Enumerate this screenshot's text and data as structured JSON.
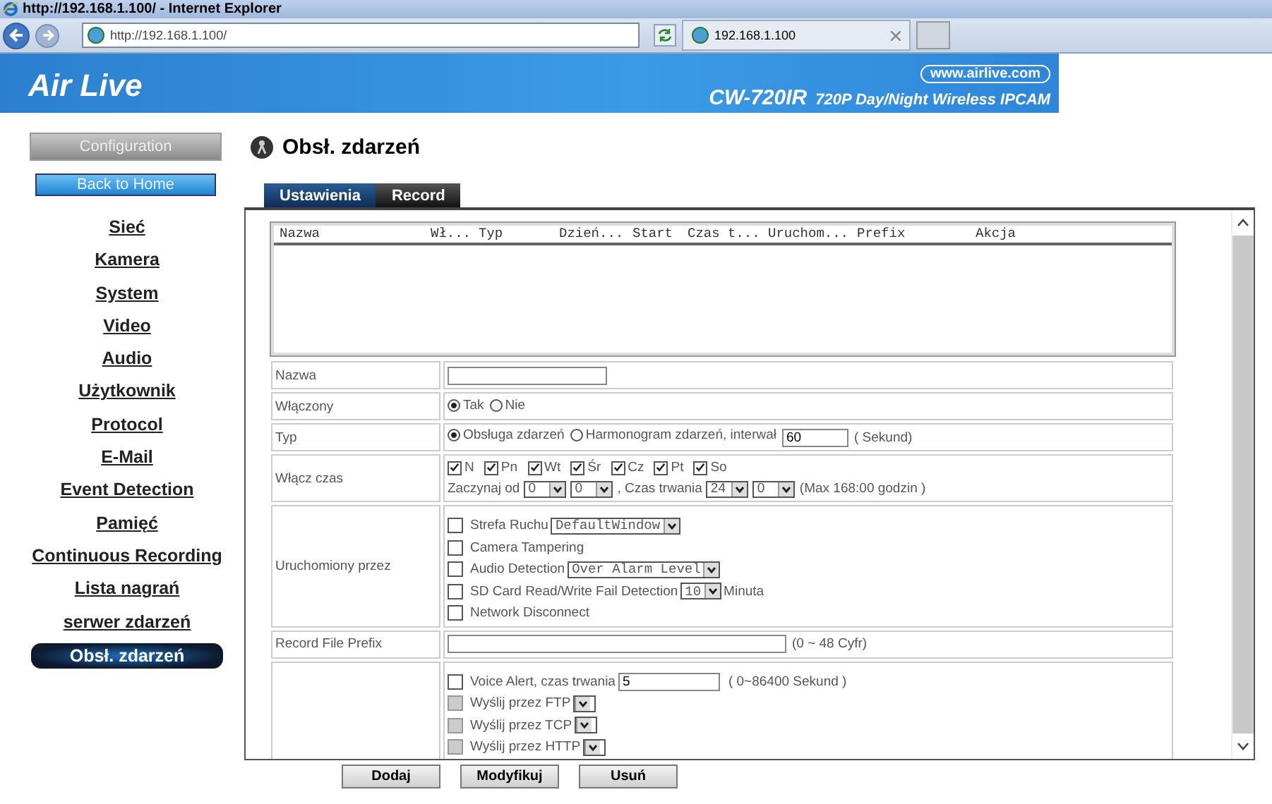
{
  "browser": {
    "title": "http://192.168.1.100/ - Internet Explorer",
    "address": "http://192.168.1.100/",
    "tab_title": "192.168.1.100"
  },
  "banner": {
    "brand": "Air Live",
    "site": "www.airlive.com",
    "model": "CW-720IR",
    "subtitle": "720P Day/Night Wireless IPCAM"
  },
  "sidebar": {
    "config_button": "Configuration",
    "home_button": "Back to Home",
    "items": [
      {
        "label": "Sieć",
        "selected": false
      },
      {
        "label": "Kamera",
        "selected": false
      },
      {
        "label": "System",
        "selected": false
      },
      {
        "label": "Video",
        "selected": false
      },
      {
        "label": "Audio",
        "selected": false
      },
      {
        "label": "Użytkownik",
        "selected": false
      },
      {
        "label": "Protocol",
        "selected": false
      },
      {
        "label": "E-Mail",
        "selected": false
      },
      {
        "label": "Event Detection",
        "selected": false
      },
      {
        "label": "Pamięć",
        "selected": false
      },
      {
        "label": "Continuous Recording",
        "selected": false
      },
      {
        "label": "Lista nagrań",
        "selected": false
      },
      {
        "label": "serwer zdarzeń",
        "selected": false
      },
      {
        "label": "Obsł. zdarzeń",
        "selected": true
      }
    ]
  },
  "page_title": "Obsł. zdarzeń",
  "tabs": [
    {
      "label": "Ustawienia",
      "selected": true
    },
    {
      "label": "Record",
      "selected": false
    }
  ],
  "event_table": {
    "columns": [
      "Nazwa",
      "Wł...",
      "Typ",
      "Dzień...",
      "Start",
      "Czas t...",
      "Uruchom...",
      "Prefix",
      "Akcja"
    ]
  },
  "name_field": {
    "label": "Nazwa"
  },
  "enabled": {
    "label": "Włączony",
    "options": [
      {
        "label": "Tak",
        "selected": true
      },
      {
        "label": "Nie",
        "selected": false
      }
    ]
  },
  "type": {
    "label": "Typ",
    "options": [
      {
        "label": "Obsługa zdarzeń",
        "selected": true
      },
      {
        "label": "Harmonogram zdarzeń, interwał",
        "selected": false
      }
    ],
    "interval": "60",
    "unit": "( Sekund)"
  },
  "schedule": {
    "label": "Włącz czas",
    "days": [
      {
        "label": "N",
        "checked": true
      },
      {
        "label": "Pn",
        "checked": true
      },
      {
        "label": "Wt",
        "checked": true
      },
      {
        "label": "Śr",
        "checked": true
      },
      {
        "label": "Cz",
        "checked": true
      },
      {
        "label": "Pt",
        "checked": true
      },
      {
        "label": "So",
        "checked": true
      }
    ],
    "start_label": "Zaczynaj od",
    "start_hour": "0",
    "start_minute": "0",
    "duration_label": ", Czas trwania",
    "duration_hour": "24",
    "duration_minute": "0",
    "note": "(Max 168:00 godzin )"
  },
  "triggers": {
    "label": "Uruchomiony przez",
    "items": [
      {
        "label": "Strefa Ruchu",
        "checked": false,
        "select": "DefaultWindow"
      },
      {
        "label": "Camera Tampering",
        "checked": false
      },
      {
        "label": "Audio Detection",
        "checked": false,
        "select": "Over Alarm Level"
      },
      {
        "label": "SD Card Read/Write Fail Detection",
        "checked": false,
        "select": "10",
        "suffix": "Minuta"
      },
      {
        "label": "Network Disconnect",
        "checked": false
      }
    ]
  },
  "prefix": {
    "label": "Record File Prefix",
    "note": "(0 ~ 48 Cyfr)"
  },
  "actions": {
    "items": [
      {
        "kind": "input",
        "label": "Voice Alert, czas trwania",
        "checked": false,
        "disabled": false,
        "value": "5",
        "note": "( 0~86400 Sekund )"
      },
      {
        "kind": "dropdown",
        "label": "Wyślij przez FTP",
        "checked": false,
        "disabled": true
      },
      {
        "kind": "dropdown",
        "label": "Wyślij przez TCP",
        "checked": false,
        "disabled": true
      },
      {
        "kind": "dropdown",
        "label": "Wyślij przez HTTP",
        "checked": false,
        "disabled": true
      }
    ]
  },
  "buttons": [
    "Dodaj",
    "Modyfikuj",
    "Usuń"
  ]
}
